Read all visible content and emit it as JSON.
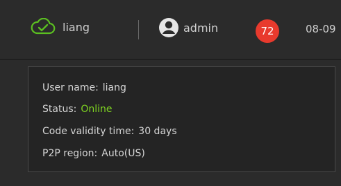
{
  "header": {
    "cloud_label": "liang",
    "user_label": "admin",
    "badge_count": "72",
    "date": "08-09",
    "cloud_icon_color": "#5bbf21",
    "badge_color": "#e83a2d"
  },
  "info": {
    "user_name": {
      "label": "User name:",
      "value": "liang"
    },
    "status": {
      "label": "Status:",
      "value": "Online",
      "value_color": "#7ed321"
    },
    "code_validity": {
      "label": "Code validity time:",
      "value": "30 days"
    },
    "p2p_region": {
      "label": "P2P region:",
      "value": "Auto(US)"
    }
  }
}
